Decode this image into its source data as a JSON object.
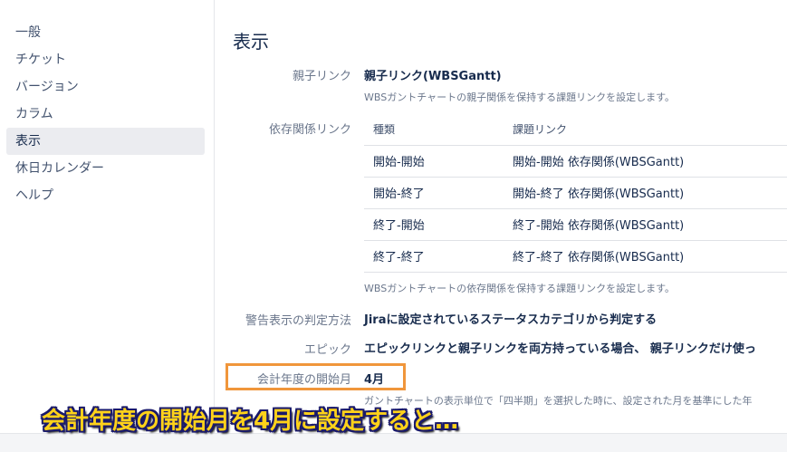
{
  "sidebar": {
    "items": [
      {
        "label": "一般"
      },
      {
        "label": "チケット"
      },
      {
        "label": "バージョン"
      },
      {
        "label": "カラム"
      },
      {
        "label": "表示"
      },
      {
        "label": "休日カレンダー"
      },
      {
        "label": "ヘルプ"
      }
    ]
  },
  "main": {
    "title": "表示",
    "parent_link": {
      "label": "親子リンク",
      "value": "親子リンク(WBSGantt)",
      "desc": "WBSガントチャートの親子関係を保持する課題リンクを設定します。"
    },
    "dependency": {
      "label": "依存関係リンク",
      "headers": [
        "種類",
        "課題リンク"
      ],
      "rows": [
        [
          "開始-開始",
          "開始-開始 依存関係(WBSGantt)"
        ],
        [
          "開始-終了",
          "開始-終了 依存関係(WBSGantt)"
        ],
        [
          "終了-開始",
          "終了-開始 依存関係(WBSGantt)"
        ],
        [
          "終了-終了",
          "終了-終了 依存関係(WBSGantt)"
        ]
      ],
      "desc": "WBSガントチャートの依存関係を保持する課題リンクを設定します。"
    },
    "warning": {
      "label": "警告表示の判定方法",
      "value": "Jiraに設定されているステータスカテゴリから判定する"
    },
    "epic": {
      "label": "エピック",
      "value": "エピックリンクと親子リンクを両方持っている場合、 親子リンクだけ使っ"
    },
    "fiscal": {
      "label": "会計年度の開始月",
      "value": "4月",
      "desc": "ガントチャートの表示単位で「四半期」を選択した時に、設定された月を基準にした年"
    }
  },
  "caption": "会計年度の開始月を4月に設定すると…",
  "colors": {
    "highlight": "#f0963b",
    "caption_fill": "#ffd21a",
    "caption_outline": "#1a1a6b",
    "active_nav_bg": "#ebecf0"
  }
}
